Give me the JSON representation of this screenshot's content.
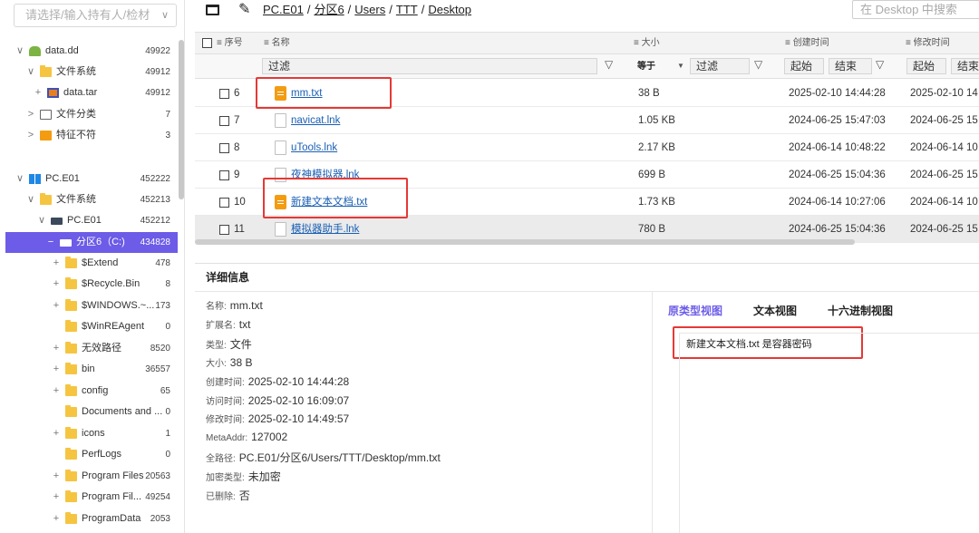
{
  "owner_select": {
    "placeholder": "请选择/输入持有人/检材"
  },
  "tree": [
    {
      "tog": "∨",
      "icon": "android-icon",
      "label": "data.dd",
      "count": "49922"
    },
    {
      "tog": "∨",
      "icon": "folder-icon",
      "label": "文件系统",
      "count": "49912"
    },
    {
      "tog": "+",
      "icon": "tar-file-icon",
      "label": "data.tar",
      "count": "49912"
    },
    {
      "tog": ">",
      "icon": "document-icon",
      "label": "文件分类",
      "count": "7"
    },
    {
      "tog": ">",
      "icon": "warning-file-icon",
      "label": "特征不符",
      "count": "3"
    },
    {
      "tog": "∨",
      "icon": "windows-icon",
      "label": "PC.E01",
      "count": "452222"
    },
    {
      "tog": "∨",
      "icon": "folder-icon",
      "label": "文件系统",
      "count": "452213"
    },
    {
      "tog": "∨",
      "icon": "drive-icon",
      "label": "PC.E01",
      "count": "452212"
    },
    {
      "tog": "−",
      "icon": "drive-icon",
      "label": "分区6（C:)",
      "count": "434828"
    },
    {
      "tog": "+",
      "icon": "folder-icon",
      "label": "$Extend",
      "count": "478"
    },
    {
      "tog": "+",
      "icon": "folder-icon",
      "label": "$Recycle.Bin",
      "count": "8"
    },
    {
      "tog": "+",
      "icon": "folder-icon",
      "label": "$WINDOWS.~...",
      "count": "173"
    },
    {
      "tog": "",
      "icon": "folder-icon",
      "label": "$WinREAgent",
      "count": "0"
    },
    {
      "tog": "+",
      "icon": "folder-icon",
      "label": "无效路径",
      "count": "8520"
    },
    {
      "tog": "+",
      "icon": "folder-icon",
      "label": "bin",
      "count": "36557"
    },
    {
      "tog": "+",
      "icon": "folder-icon",
      "label": "config",
      "count": "65"
    },
    {
      "tog": "",
      "icon": "folder-icon",
      "label": "Documents and ...",
      "count": "0"
    },
    {
      "tog": "+",
      "icon": "folder-icon",
      "label": "icons",
      "count": "1"
    },
    {
      "tog": "",
      "icon": "folder-icon",
      "label": "PerfLogs",
      "count": "0"
    },
    {
      "tog": "+",
      "icon": "folder-icon",
      "label": "Program Files",
      "count": "20563"
    },
    {
      "tog": "+",
      "icon": "folder-icon",
      "label": "Program Fil...",
      "count": "49254"
    },
    {
      "tog": "+",
      "icon": "folder-icon",
      "label": "ProgramData",
      "count": "2053"
    }
  ],
  "toolbar": {
    "breadcrumb": [
      "PC.E01",
      "分区6",
      "Users",
      "TTT",
      "Desktop"
    ],
    "search_placeholder": "在 Desktop 中搜索"
  },
  "grid": {
    "columns": {
      "index": "≡ 序号",
      "name": "≡ 名称",
      "size": "≡ 大小",
      "created": "≡ 创建时间",
      "modified": "≡ 修改时间"
    },
    "filter": {
      "name_placeholder": "过滤",
      "size_op": "等于",
      "size_placeholder": "过滤",
      "created_start": "起始",
      "created_end": "结束",
      "modified_start": "起始",
      "modified_end": "结束"
    },
    "rows": [
      {
        "index": "6",
        "name": "mm.txt",
        "type": "txt",
        "size": "38 B",
        "created": "2025-02-10 14:44:28",
        "modified": "2025-02-10 14"
      },
      {
        "index": "7",
        "name": "navicat.lnk",
        "type": "lnk",
        "size": "1.05 KB",
        "created": "2024-06-25 15:47:03",
        "modified": "2024-06-25 15"
      },
      {
        "index": "8",
        "name": "uTools.lnk",
        "type": "lnk",
        "size": "2.17 KB",
        "created": "2024-06-14 10:48:22",
        "modified": "2024-06-14 10"
      },
      {
        "index": "9",
        "name": "夜神模拟器.lnk",
        "type": "lnk",
        "size": "699 B",
        "created": "2024-06-25 15:04:36",
        "modified": "2024-06-25 15"
      },
      {
        "index": "10",
        "name": "新建文本文档.txt",
        "type": "txt",
        "size": "1.73 KB",
        "created": "2024-06-14 10:27:06",
        "modified": "2024-06-14 10"
      },
      {
        "index": "11",
        "name": "模拟器助手.lnk",
        "type": "lnk",
        "size": "780 B",
        "created": "2024-06-25 15:04:36",
        "modified": "2024-06-25 15"
      }
    ]
  },
  "details": {
    "title": "详细信息",
    "props": [
      {
        "label": "名称:",
        "value": "mm.txt"
      },
      {
        "label": "扩展名:",
        "value": "txt"
      },
      {
        "label": "类型:",
        "value": "文件"
      },
      {
        "label": "大小:",
        "value": "38 B"
      },
      {
        "label": "创建时间:",
        "value": "2025-02-10 14:44:28"
      },
      {
        "label": "访问时间:",
        "value": "2025-02-10 16:09:07"
      },
      {
        "label": "修改时间:",
        "value": "2025-02-10 14:49:57"
      },
      {
        "label": "MetaAddr:",
        "value": "127002"
      },
      {
        "label": "全路径:",
        "value": "PC.E01/分区6/Users/TTT/Desktop/mm.txt"
      },
      {
        "label": "加密类型:",
        "value": "未加密"
      },
      {
        "label": "已删除:",
        "value": "否"
      }
    ],
    "tabs": [
      "原类型视图",
      "文本视图",
      "十六进制视图"
    ],
    "preview_text": "新建文本文档.txt 是容器密码"
  },
  "accent_color": "#6c5ce7",
  "highlight_color": "#e53935"
}
